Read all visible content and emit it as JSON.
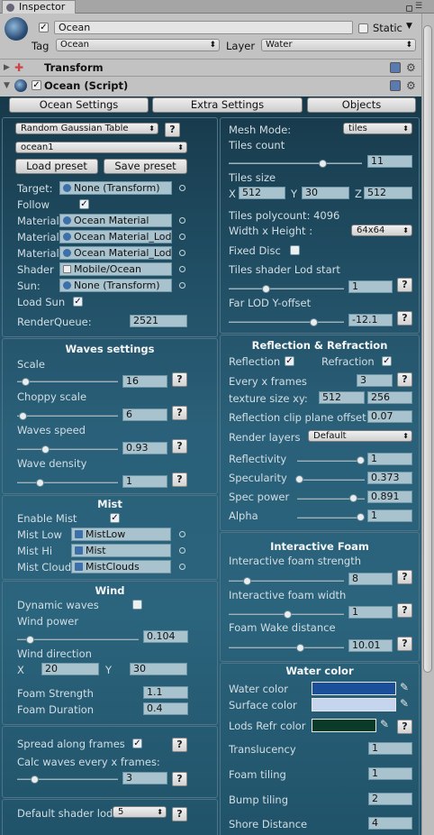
{
  "window": {
    "tab_title": "Inspector"
  },
  "object": {
    "name": "Ocean",
    "static_label": "Static",
    "tag_label": "Tag",
    "tag_value": "Ocean",
    "layer_label": "Layer",
    "layer_value": "Water"
  },
  "components": {
    "transform": "Transform",
    "script": "Ocean (Script)"
  },
  "tabs": [
    "Ocean Settings",
    "Extra Settings",
    "Objects"
  ],
  "left": {
    "table_dropdown": "Random Gaussian Table",
    "q": "?",
    "preset_dropdown": "ocean1",
    "load_preset": "Load preset",
    "save_preset": "Save preset",
    "rows": [
      {
        "label": "Target:",
        "value": "None (Transform)"
      },
      {
        "label": "Material",
        "value": "Ocean Material"
      },
      {
        "label": "Material",
        "value": "Ocean Material_Lod"
      },
      {
        "label": "Material",
        "value": "Ocean Material_Lod"
      },
      {
        "label": "Shader",
        "value": "Mobile/Ocean"
      },
      {
        "label": "Sun:",
        "value": "None (Transform)"
      }
    ],
    "follow": "Follow",
    "load_sun": "Load Sun",
    "render_queue_label": "RenderQueue:",
    "render_queue": "2521",
    "waves": {
      "title": "Waves settings",
      "scale": "Scale",
      "scale_v": "16",
      "choppy": "Choppy scale",
      "choppy_v": "6",
      "speed": "Waves speed",
      "speed_v": "0.93",
      "density": "Wave density",
      "density_v": "1"
    },
    "mist": {
      "title": "Mist",
      "enable": "Enable Mist",
      "low": "Mist Low",
      "low_v": "MistLow",
      "hi": "Mist Hi",
      "hi_v": "Mist",
      "cloud": "Mist Cloud",
      "cloud_v": "MistClouds"
    },
    "wind": {
      "title": "Wind",
      "dynamic": "Dynamic waves",
      "power": "Wind power",
      "power_v": "0.104",
      "direction": "Wind direction",
      "x": "X",
      "x_v": "20",
      "y": "Y",
      "y_v": "30",
      "foam_strength": "Foam Strength",
      "foam_strength_v": "1.1",
      "foam_duration": "Foam Duration",
      "foam_duration_v": "0.4"
    },
    "spread": {
      "spread": "Spread along frames",
      "calc": "Calc waves every x frames:",
      "calc_v": "3"
    },
    "shader_lod": {
      "label": "Default shader lod",
      "value": "5"
    }
  },
  "right": {
    "mesh_mode": "Mesh Mode:",
    "mesh_mode_v": "tiles",
    "tiles_count": "Tiles count",
    "tiles_count_v": "11",
    "tiles_size": "Tiles size",
    "tx": "X",
    "tx_v": "512",
    "ty": "Y",
    "ty_v": "30",
    "tz": "Z",
    "tz_v": "512",
    "polycount": "Tiles polycount: 4096",
    "wh": "Width x Height :",
    "wh_v": "64x64",
    "fixed_disc": "Fixed Disc",
    "lod_start": "Tiles shader Lod start",
    "lod_start_v": "1",
    "far_lod": "Far LOD Y-offset",
    "far_lod_v": "-12.1",
    "refl": {
      "title": "Reflection & Refraction",
      "reflection": "Reflection",
      "refraction": "Refraction",
      "every": "Every x frames",
      "every_v": "3",
      "tex": "texture size  xy:",
      "tex_x": "512",
      "tex_y": "256",
      "clip": "Reflection clip plane offset",
      "clip_v": "0.07",
      "layers": "Render layers",
      "layers_v": "Default",
      "reflectivity": "Reflectivity",
      "reflectivity_v": "1",
      "specularity": "Specularity",
      "specularity_v": "0.373",
      "spec_power": "Spec power",
      "spec_power_v": "0.891",
      "alpha": "Alpha",
      "alpha_v": "1"
    },
    "foam": {
      "title": "Interactive Foam",
      "strength": "Interactive foam strength",
      "strength_v": "8",
      "width": "Interactive foam width",
      "width_v": "1",
      "wake": "Foam Wake distance",
      "wake_v": "10.01"
    },
    "water": {
      "title": "Water color",
      "water": "Water color",
      "surface": "Surface color",
      "lods": "Lods Refr color",
      "translucency": "Translucency",
      "translucency_v": "1",
      "foam_tiling": "Foam tiling",
      "foam_tiling_v": "1",
      "bump": "Bump tiling",
      "bump_v": "2",
      "shore": "Shore Distance",
      "shore_v": "4"
    }
  },
  "colors": {
    "water": "#1c4f9a",
    "surface": "#c5d5ee",
    "lods": "#0b3a28"
  }
}
